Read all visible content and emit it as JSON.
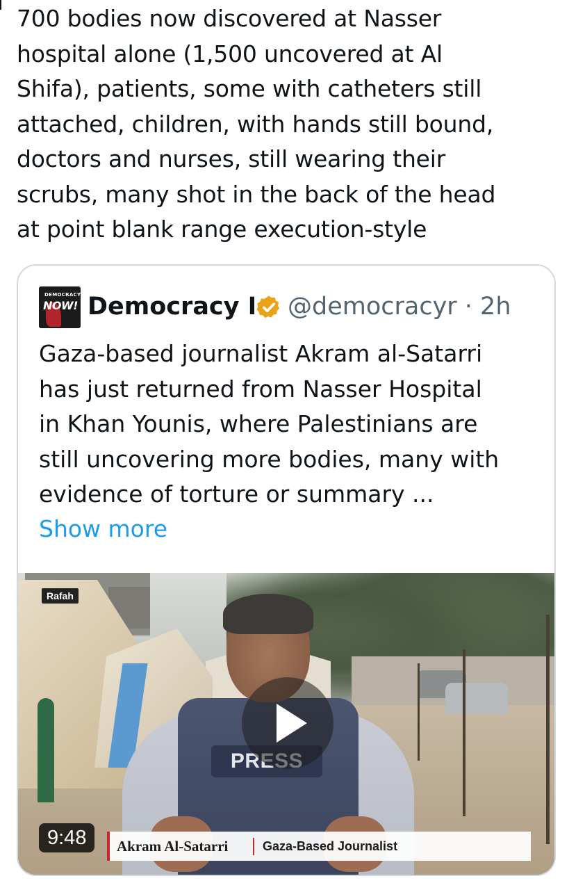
{
  "tweet": {
    "lines": [
      "700 bodies now discovered at Nasser",
      "hospital alone (1,500 uncovered at Al",
      "Shifa), patients, some with catheters still",
      "attached, children, with hands still bound,",
      "doctors and nurses, still wearing their",
      "scrubs, many shot in the back of the head",
      "at point blank range execution-style"
    ]
  },
  "quote": {
    "avatar_text_top": "DEMOCRACY",
    "avatar_text_main": "NOW!",
    "display_name": "Democracy Now!",
    "verified_icon": "verified-badge-icon",
    "verified_color": "#e8a317",
    "handle_time": "@democracyr · 2h",
    "body_lines": [
      "Gaza-based journalist Akram al-Satarri",
      "has just returned from Nasser Hospital",
      "in Khan Younis, where Palestinians are",
      "still uncovering more bodies, many with",
      "evidence of torture or summary ..."
    ],
    "show_more": "Show more",
    "link_color": "#1d9bf0",
    "video": {
      "location_badge": "Rafah",
      "press_text": "PRESS",
      "play_icon": "play-icon",
      "duration": "9:48",
      "lower_third_name": "Akram Al-Satarri",
      "lower_third_title": "Gaza-Based Journalist"
    }
  }
}
